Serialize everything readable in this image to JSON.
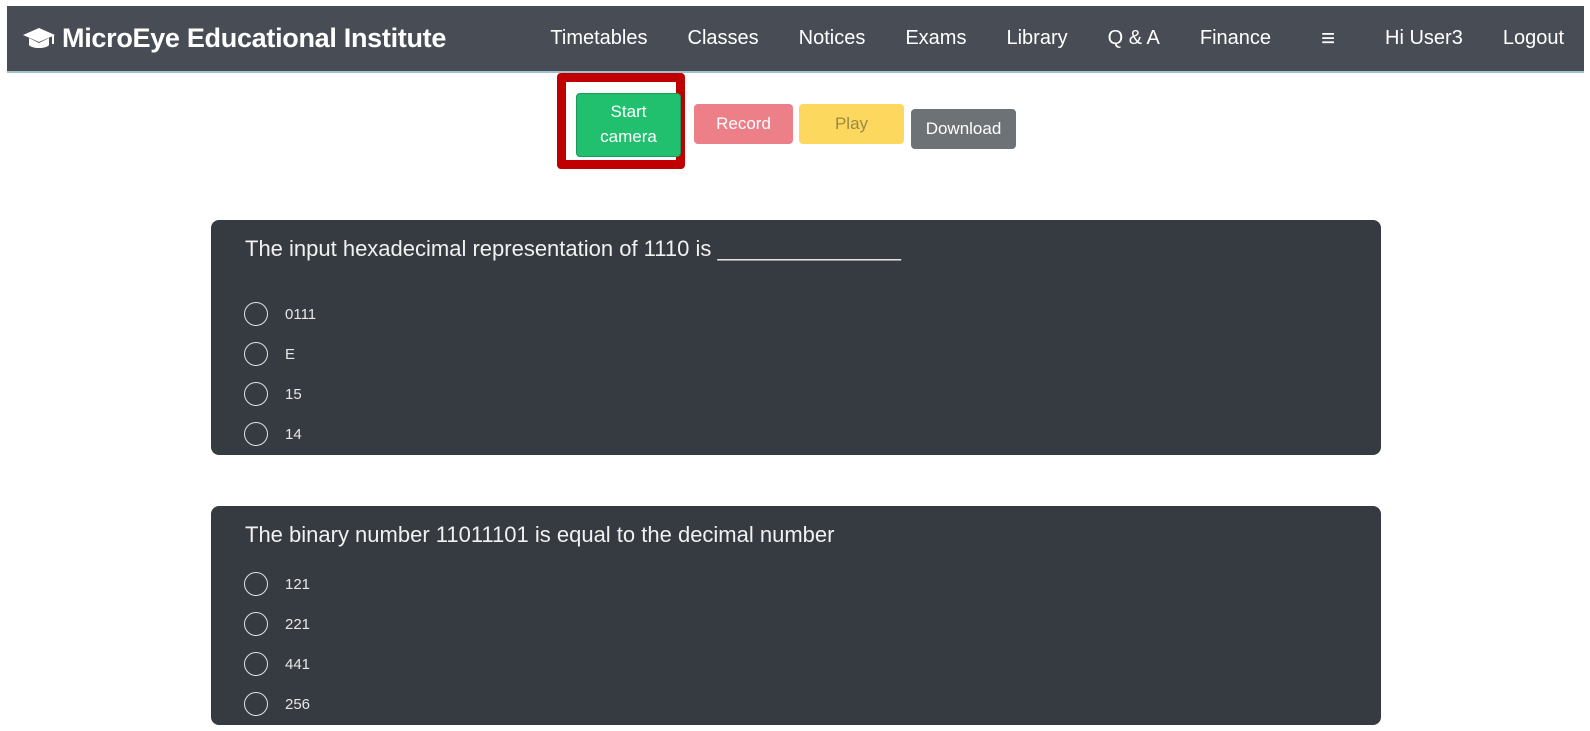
{
  "navbar": {
    "brand": "MicroEye Educational Institute",
    "brand_icon": "graduation-cap-icon",
    "items": [
      {
        "label": "Timetables"
      },
      {
        "label": "Classes"
      },
      {
        "label": "Notices"
      },
      {
        "label": "Exams"
      },
      {
        "label": "Library"
      },
      {
        "label": "Q & A"
      },
      {
        "label": "Finance"
      }
    ],
    "menu_icon": "≡",
    "user": "Hi User3",
    "logout": "Logout"
  },
  "toolbar": {
    "start_camera": "Start camera",
    "record": "Record",
    "play": "Play",
    "download": "Download"
  },
  "questions": [
    {
      "text": "The input hexadecimal representation of 1110 is _______________",
      "options": [
        "0111",
        "E",
        "15",
        "14"
      ]
    },
    {
      "text": "The binary number 11011101 is equal to the decimal number",
      "options": [
        "121",
        "221",
        "441",
        "256"
      ]
    }
  ],
  "colors": {
    "navbar_bg": "#484d55",
    "start_camera": "#21c06f",
    "record": "#ec7f88",
    "play": "#fdd85e",
    "download": "#6d7276",
    "card_bg": "#363a41",
    "highlight": "#c00000"
  }
}
